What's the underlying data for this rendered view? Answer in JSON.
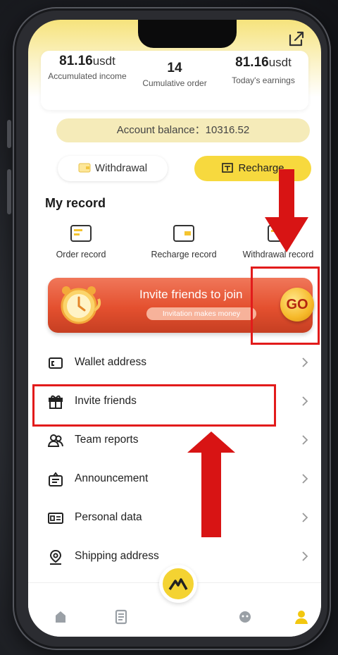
{
  "stats": [
    {
      "value": "81.16",
      "unit": "usdt",
      "label": "Accumulated income"
    },
    {
      "value": "14",
      "unit": "",
      "label": "Cumulative order"
    },
    {
      "value": "81.16",
      "unit": "usdt",
      "label": "Today's earnings"
    }
  ],
  "balance": {
    "label": "Account balance：",
    "amount": "10316.52"
  },
  "actions": {
    "withdraw": "Withdrawal",
    "recharge": "Recharge"
  },
  "my_record": {
    "title": "My record",
    "items": [
      "Order record",
      "Recharge record",
      "Withdrawal record"
    ]
  },
  "banner": {
    "title": "Invite friends to join",
    "subtitle": "Invitation makes money",
    "go": "GO"
  },
  "menu": [
    {
      "label": "Wallet address",
      "icon": "wallet-icon"
    },
    {
      "label": "Invite friends",
      "icon": "gift-icon"
    },
    {
      "label": "Team reports",
      "icon": "team-icon"
    },
    {
      "label": "Announcement",
      "icon": "announcement-icon"
    },
    {
      "label": "Personal data",
      "icon": "id-card-icon"
    },
    {
      "label": "Shipping address",
      "icon": "location-pin-icon"
    }
  ],
  "tabbar": [
    "home-icon",
    "orders-icon",
    "center-logo-icon",
    "service-icon",
    "profile-icon"
  ],
  "colors": {
    "accent": "#f7d93e",
    "highlight": "#e21b1b",
    "banner": "#e4502f"
  }
}
